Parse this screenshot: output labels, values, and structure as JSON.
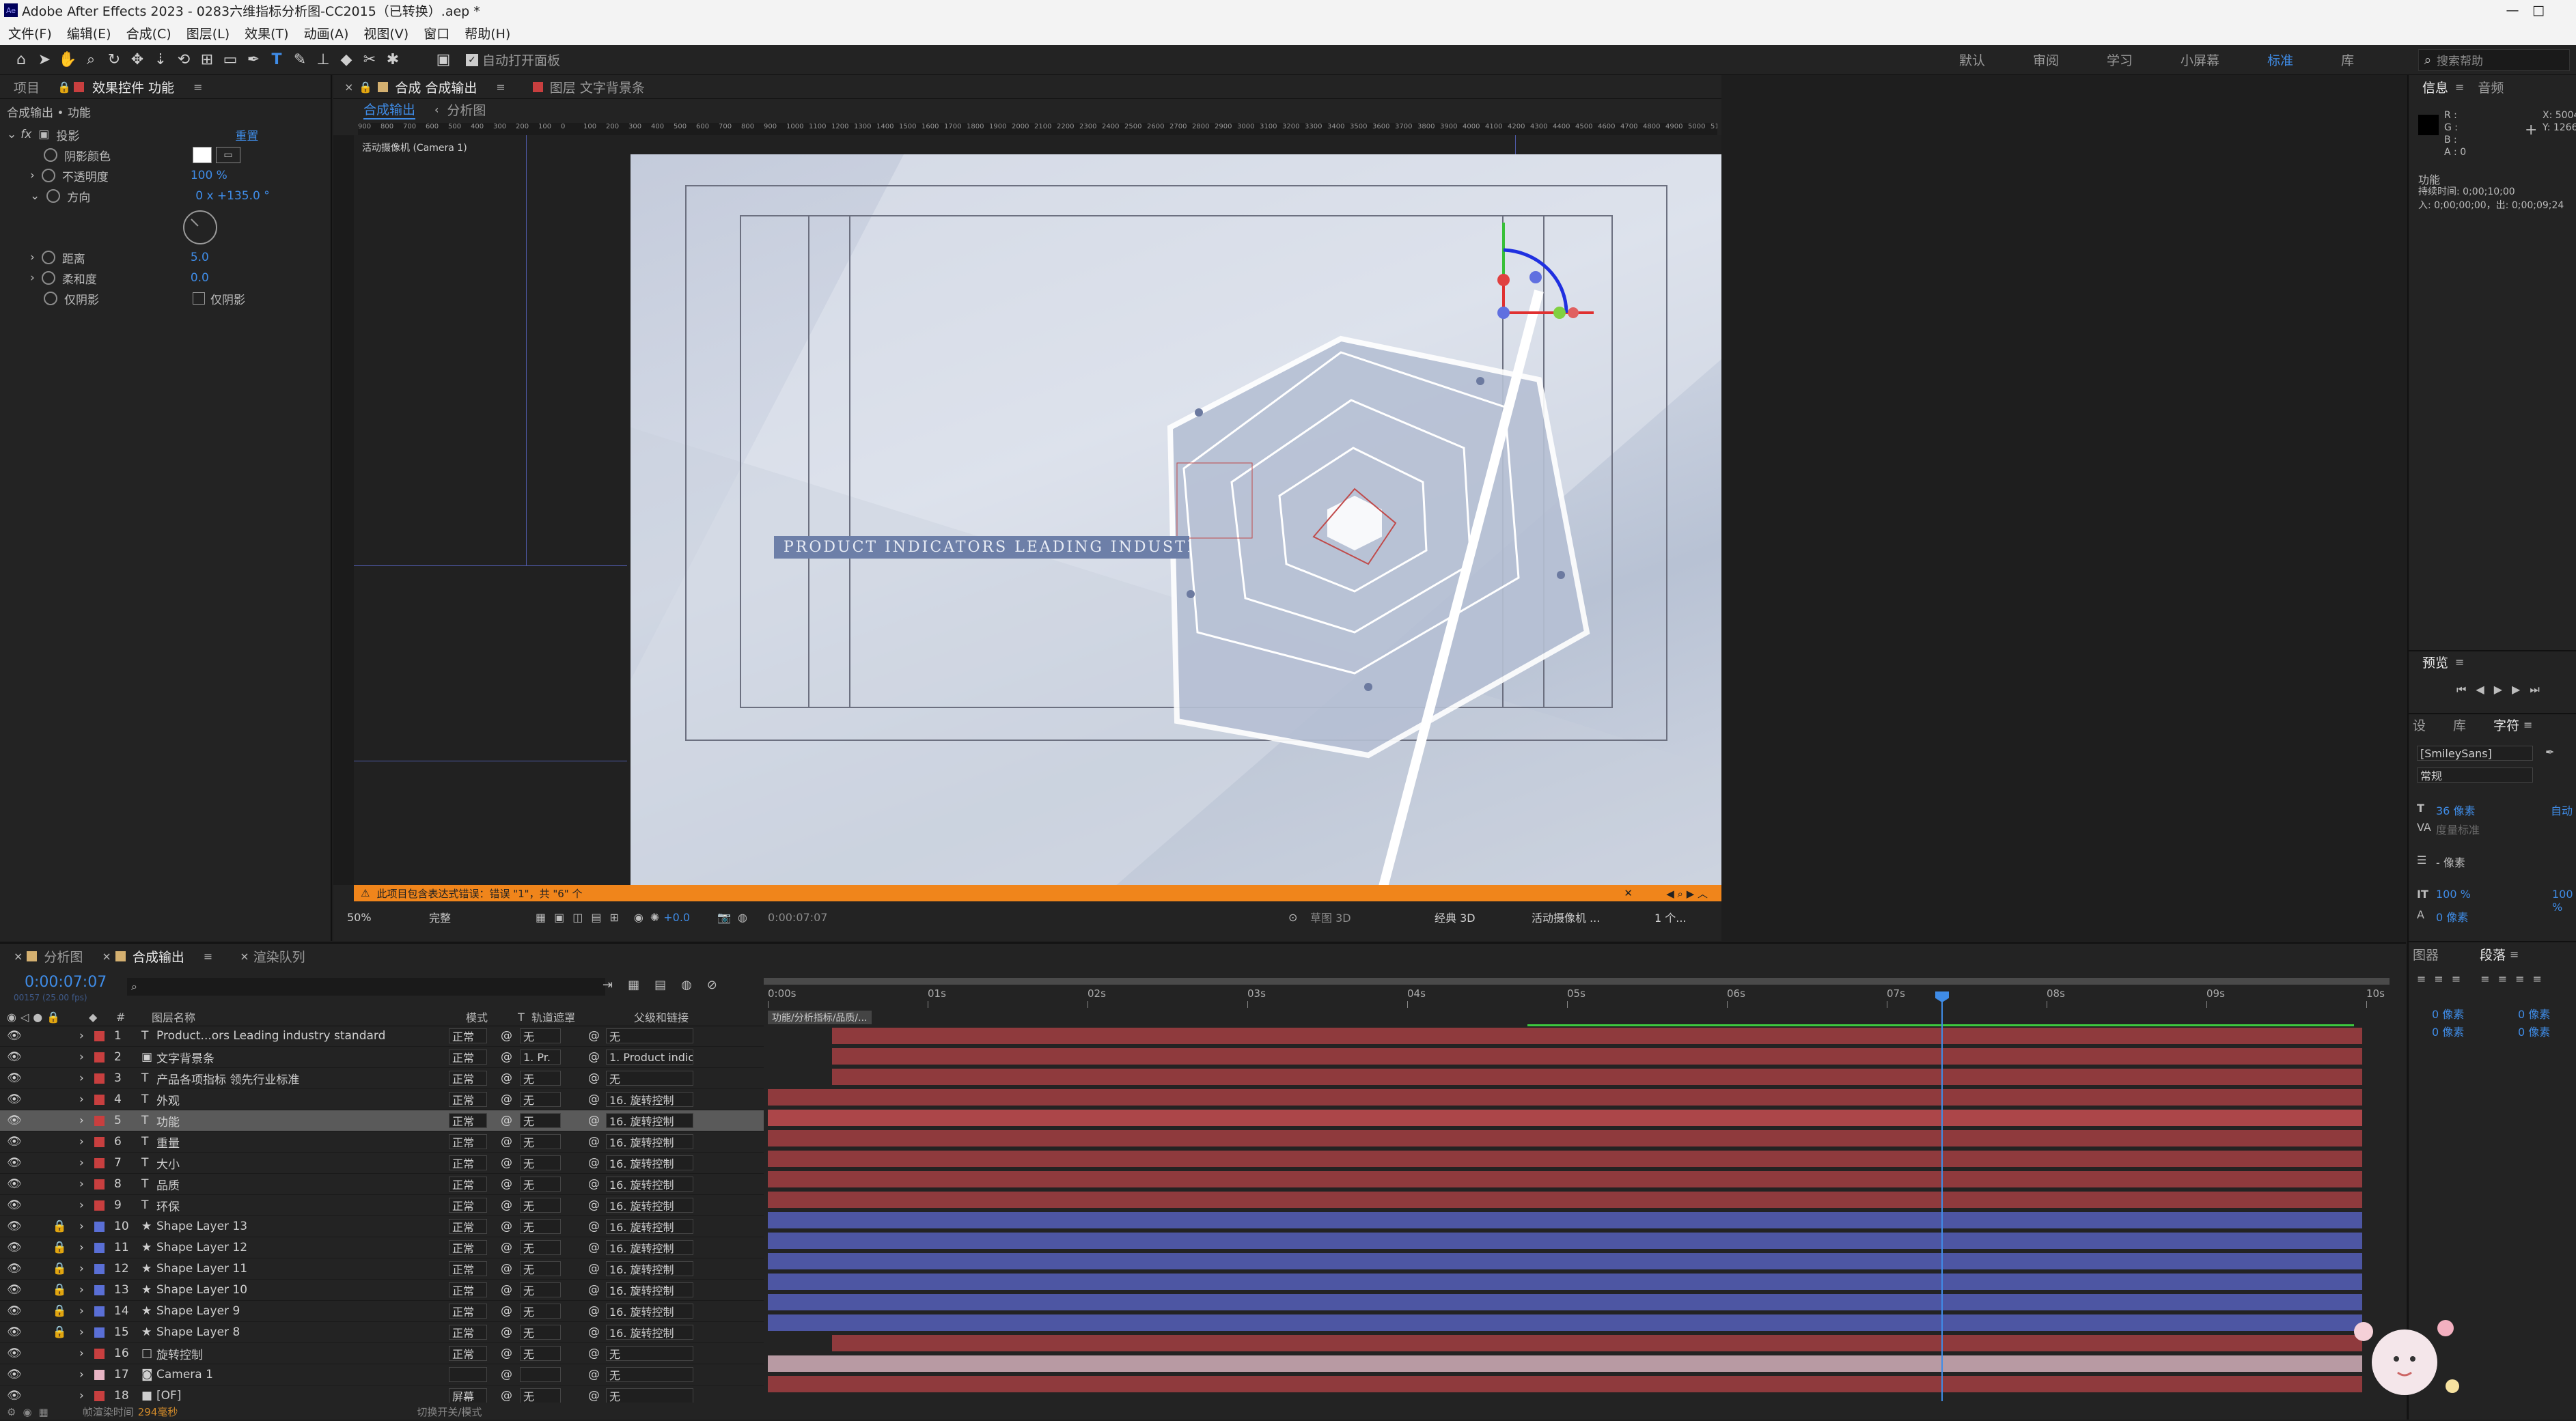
{
  "app": {
    "title": "Adobe After Effects 2023 - 0283六维指标分析图-CC2015（已转换）.aep *"
  },
  "menu": [
    "文件(F)",
    "编辑(E)",
    "合成(C)",
    "图层(L)",
    "效果(T)",
    "动画(A)",
    "视图(V)",
    "窗口",
    "帮助(H)"
  ],
  "toolbar": {
    "auto_open": "自动打开面板",
    "workspaces": [
      "默认",
      "审阅",
      "学习",
      "小屏幕",
      "标准",
      "库"
    ],
    "active_ws": "标准",
    "search_placeholder": "搜索帮助"
  },
  "left_panel": {
    "tabs": [
      "项目",
      "效果控件 功能"
    ],
    "breadcrumb": "合成输出 • 功能",
    "effect_name": "投影",
    "reset": "重置",
    "props": [
      {
        "label": "阴影颜色",
        "value": ""
      },
      {
        "label": "不透明度",
        "value": "100 %"
      },
      {
        "label": "方向",
        "value": "0 x +135.0 °"
      },
      {
        "label": "距离",
        "value": "5.0"
      },
      {
        "label": "柔和度",
        "value": "0.0"
      },
      {
        "label": "仅阴影",
        "value": "仅阴影"
      }
    ]
  },
  "viewer": {
    "tabs": [
      "合成 合成输出",
      "图层 文字背景条"
    ],
    "subtabs": [
      "合成输出",
      "分析图"
    ],
    "camera": "活动摄像机 (Camera 1)",
    "text_overlay": "PRODUCT INDICATORS LEADING INDUSTRY",
    "warning": "此项目包含表达式错误：错误 \"1\"，共 \"6\" 个",
    "zoom": "50%",
    "quality": "完整",
    "timecode": "0:00:07:07",
    "offset": "+0.0",
    "renderer": "经典 3D",
    "view": "活动摄像机 ...",
    "views_count": "1 个...",
    "draft": "草图 3D",
    "ruler": [
      "900",
      "800",
      "700",
      "600",
      "500",
      "400",
      "300",
      "200",
      "100",
      "0",
      "100",
      "200",
      "300",
      "400",
      "500",
      "600",
      "700",
      "800",
      "900",
      "1000",
      "1100",
      "1200",
      "1300",
      "1400",
      "1500",
      "1600",
      "1700",
      "1800",
      "1900",
      "2000",
      "2100",
      "2200",
      "2300",
      "2400",
      "2500",
      "2600",
      "2700",
      "2800",
      "2900",
      "3000",
      "3100",
      "3200",
      "3300",
      "3400",
      "3500",
      "3600",
      "3700",
      "3800",
      "3900",
      "4000",
      "4100",
      "4200",
      "4300",
      "4400",
      "4500",
      "4600",
      "4700",
      "4800",
      "4900",
      "5000",
      "5100"
    ]
  },
  "right_panel": {
    "info_tabs": [
      "信息",
      "音频"
    ],
    "rgb": [
      "R :",
      "G :",
      "B :",
      "A : 0"
    ],
    "xy": [
      "X: 5004",
      "Y: 1266"
    ],
    "func": "功能",
    "duration": "持续时间: 0;00;10;00",
    "inout": "入: 0;00;00;00，出: 0;00;09;24",
    "preview": "预览",
    "char_tabs": [
      "设",
      "库",
      "字符"
    ],
    "font": "[SmileySans]",
    "style": "常规",
    "size": "36 像素",
    "auto": "自动",
    "metrics": "度量标准",
    "px": "- 像素",
    "scale1": "100 %",
    "scale2": "100 %",
    "zero_px": "0 像素",
    "para_tabs": [
      "图器",
      "段落"
    ],
    "para_vals": [
      "0 像素",
      "0 像素",
      "0 像素",
      "0 像素"
    ]
  },
  "timeline": {
    "tabs": [
      "分析图",
      "合成输出",
      "渲染队列"
    ],
    "timecode": "0:00:07:07",
    "fps": "00157 (25.00 fps)",
    "col_headers": [
      "#",
      "图层名称",
      "模式",
      "T",
      "轨道遮罩",
      "父级和链接"
    ],
    "ticks": [
      "0:00s",
      "01s",
      "02s",
      "03s",
      "04s",
      "05s",
      "06s",
      "07s",
      "08s",
      "09s",
      "10s"
    ],
    "footer": [
      "帧渲染时间",
      "294毫秒",
      "切换开关/模式"
    ],
    "marker": "功能/分析指标/品质/...",
    "layers": [
      {
        "n": "1",
        "name": "Product...ors Leading industry standard",
        "type": "T",
        "mode": "正常",
        "mask": "无",
        "parent": "无",
        "color": "#c83f3f",
        "bar": "red",
        "start": 0.04,
        "lock": false
      },
      {
        "n": "2",
        "name": "文字背景条",
        "type": "img",
        "mode": "正常",
        "mask": "1. Pr.",
        "parent": "1. Product indic",
        "color": "#c83f3f",
        "bar": "red",
        "start": 0.04,
        "lock": false
      },
      {
        "n": "3",
        "name": "产品各项指标  领先行业标准",
        "type": "T",
        "mode": "正常",
        "mask": "无",
        "parent": "无",
        "color": "#c83f3f",
        "bar": "red",
        "start": 0.04,
        "lock": false
      },
      {
        "n": "4",
        "name": "外观",
        "type": "T",
        "mode": "正常",
        "mask": "无",
        "parent": "16. 旋转控制",
        "color": "#c83f3f",
        "bar": "red",
        "start": 0,
        "lock": false
      },
      {
        "n": "5",
        "name": "功能",
        "type": "T",
        "mode": "正常",
        "mask": "无",
        "parent": "16. 旋转控制",
        "color": "#c83f3f",
        "bar": "red",
        "start": 0,
        "lock": false,
        "sel": true
      },
      {
        "n": "6",
        "name": "重量",
        "type": "T",
        "mode": "正常",
        "mask": "无",
        "parent": "16. 旋转控制",
        "color": "#c83f3f",
        "bar": "red",
        "start": 0,
        "lock": false
      },
      {
        "n": "7",
        "name": "大小",
        "type": "T",
        "mode": "正常",
        "mask": "无",
        "parent": "16. 旋转控制",
        "color": "#c83f3f",
        "bar": "red",
        "start": 0,
        "lock": false
      },
      {
        "n": "8",
        "name": "品质",
        "type": "T",
        "mode": "正常",
        "mask": "无",
        "parent": "16. 旋转控制",
        "color": "#c83f3f",
        "bar": "red",
        "start": 0,
        "lock": false
      },
      {
        "n": "9",
        "name": "环保",
        "type": "T",
        "mode": "正常",
        "mask": "无",
        "parent": "16. 旋转控制",
        "color": "#c83f3f",
        "bar": "red",
        "start": 0,
        "lock": false
      },
      {
        "n": "10",
        "name": "Shape Layer 13",
        "type": "star",
        "mode": "正常",
        "mask": "无",
        "parent": "16. 旋转控制",
        "color": "#5a6fd6",
        "bar": "blue",
        "start": 0,
        "lock": true
      },
      {
        "n": "11",
        "name": "Shape Layer 12",
        "type": "star",
        "mode": "正常",
        "mask": "无",
        "parent": "16. 旋转控制",
        "color": "#5a6fd6",
        "bar": "blue",
        "start": 0,
        "lock": true
      },
      {
        "n": "12",
        "name": "Shape Layer 11",
        "type": "star",
        "mode": "正常",
        "mask": "无",
        "parent": "16. 旋转控制",
        "color": "#5a6fd6",
        "bar": "blue",
        "start": 0,
        "lock": true
      },
      {
        "n": "13",
        "name": "Shape Layer 10",
        "type": "star",
        "mode": "正常",
        "mask": "无",
        "parent": "16. 旋转控制",
        "color": "#5a6fd6",
        "bar": "blue",
        "start": 0,
        "lock": true
      },
      {
        "n": "14",
        "name": "Shape Layer 9",
        "type": "star",
        "mode": "正常",
        "mask": "无",
        "parent": "16. 旋转控制",
        "color": "#5a6fd6",
        "bar": "blue",
        "start": 0,
        "lock": true
      },
      {
        "n": "15",
        "name": "Shape Layer 8",
        "type": "star",
        "mode": "正常",
        "mask": "无",
        "parent": "16. 旋转控制",
        "color": "#5a6fd6",
        "bar": "blue",
        "start": 0,
        "lock": true
      },
      {
        "n": "16",
        "name": "旋转控制",
        "type": "null",
        "mode": "正常",
        "mask": "无",
        "parent": "无",
        "color": "#c83f3f",
        "bar": "red",
        "start": 0.04,
        "lock": false
      },
      {
        "n": "17",
        "name": "Camera 1",
        "type": "cam",
        "mode": "",
        "mask": "",
        "parent": "无",
        "color": "#e8b4c4",
        "bar": "pink",
        "start": 0,
        "lock": false
      },
      {
        "n": "18",
        "name": "[OF]",
        "type": "solid",
        "mode": "屏幕",
        "mask": "无",
        "parent": "无",
        "color": "#c83f3f",
        "bar": "red",
        "start": 0,
        "lock": false
      }
    ]
  },
  "colors": {
    "accent": "#3f8ce7",
    "bar_red": "#8f3a3d",
    "bar_blue": "#4d56a3",
    "bar_pink": "#b89aa3",
    "warning": "#f0851b",
    "playhead": "#3f8ce7"
  }
}
